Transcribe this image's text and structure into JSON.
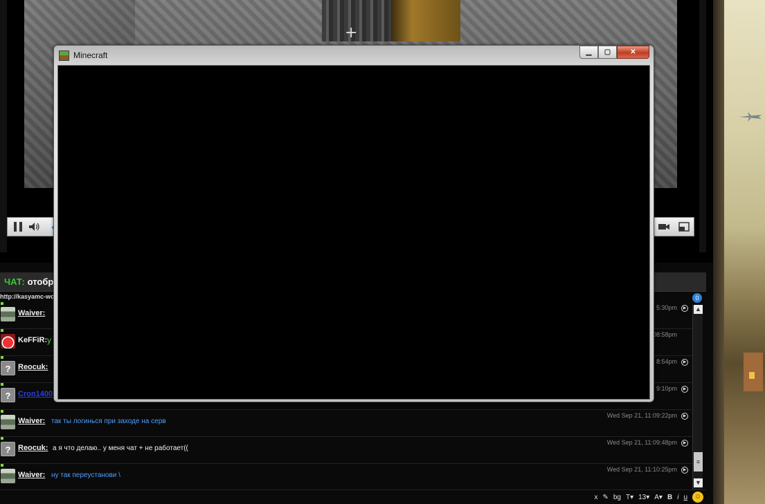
{
  "video": {
    "crosshair": "+"
  },
  "controls": {
    "pause_icon": "pause-icon",
    "volume_icon": "volume-icon",
    "camera_icon": "camera-icon",
    "fullscreen_icon": "fullscreen-icon"
  },
  "minecraft_window": {
    "title": "Minecraft",
    "min_label": "▁",
    "max_label": "▢",
    "close_label": "✕"
  },
  "chat": {
    "header_label_green": "ЧАТ:",
    "header_label_white": "отобр",
    "url_line": "http://kasyamc-wo",
    "unread_count": "0",
    "messages": [
      {
        "avatar": "tank",
        "nick": "Waiver:",
        "text": "",
        "time": "5:30pm"
      },
      {
        "avatar": "red",
        "nick": "KeFFiR:",
        "text": "у",
        "time": "11:08:58pm"
      },
      {
        "avatar": "q",
        "nick": "Reocuk:",
        "text": "",
        "time": "8:54pm"
      },
      {
        "avatar": "q",
        "nick": "Cron1400",
        "text": "",
        "time": "9:10pm"
      },
      {
        "avatar": "tank",
        "nick": "Waiver:",
        "text": "так ты логинься при заходе на серв",
        "time": "Wed Sep 21, 11:09:22pm"
      },
      {
        "avatar": "q",
        "nick": "Reocuk:",
        "text": "а я что делаю.. у меня чат + не работает((",
        "time": "Wed Sep 21, 11:09:48pm"
      },
      {
        "avatar": "tank",
        "nick": "Waiver:",
        "text": "ну так переустанови \\",
        "time": "Wed Sep 21, 11:10:25pm"
      }
    ],
    "toolbar": {
      "clear": "x",
      "pen": "✎",
      "bg": "bg",
      "font": "T▾",
      "size": "13▾",
      "color": "A▾",
      "bold": "B",
      "italic": "i",
      "underline": "u",
      "smile": "☺"
    },
    "scroll": {
      "up": "▲",
      "down": "▼",
      "thumb": "≡"
    }
  }
}
